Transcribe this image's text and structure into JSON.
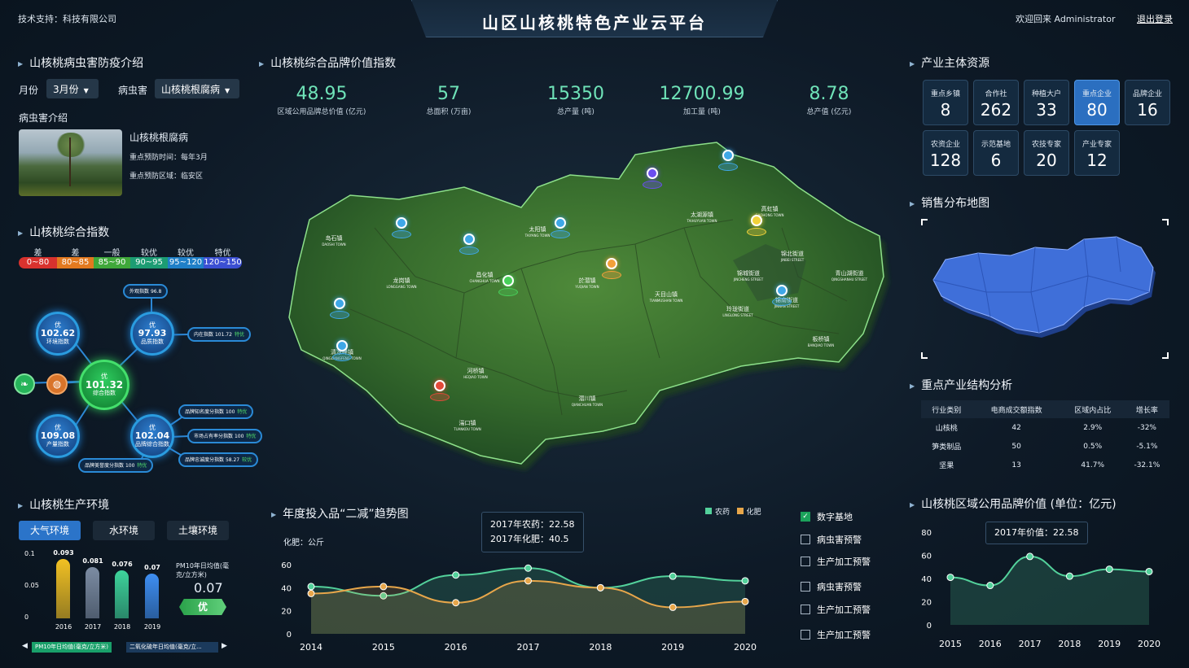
{
  "header": {
    "title": "山区山核桃特色产业云平台",
    "support": "技术支持：科技有限公司",
    "welcome": "欢迎回来  Administrator",
    "logout": "退出登录"
  },
  "pest": {
    "title": "山核桃病虫害防疫介绍",
    "month_label": "月份",
    "month_value": "3月份",
    "pest_label": "病虫害",
    "pest_value": "山核桃根腐病",
    "intro_label": "病虫害介绍",
    "name": "山核桃根腐病",
    "time": "重点预防时间：每年3月",
    "area": "重点预防区域：临安区"
  },
  "index": {
    "title": "山核桃综合指数",
    "scale": [
      {
        "grade": "差",
        "range": "0~80",
        "color": "#d8322e"
      },
      {
        "grade": "差",
        "range": "80~85",
        "color": "#e2791f"
      },
      {
        "grade": "一般",
        "range": "85~90",
        "color": "#3fa83a"
      },
      {
        "grade": "较优",
        "range": "90~95",
        "color": "#1c9c73"
      },
      {
        "grade": "较优",
        "range": "95~120",
        "color": "#1f7fc7"
      },
      {
        "grade": "特优",
        "range": "120~150",
        "color": "#3b4fd2"
      }
    ],
    "center": {
      "grade": "优",
      "value": "101.32",
      "name": "综合指数"
    },
    "env": {
      "grade": "优",
      "value": "102.62",
      "name": "环境指数"
    },
    "quality": {
      "grade": "优",
      "value": "97.93",
      "name": "品质指数"
    },
    "product": {
      "grade": "优",
      "value": "109.08",
      "name": "产量指数"
    },
    "brand": {
      "grade": "优",
      "value": "102.04",
      "name": "品牌综合指数"
    },
    "pills": {
      "appearance": {
        "label": "外观指数",
        "value": "96.8"
      },
      "inner": {
        "label": "内在指数",
        "value": "101.72",
        "grade": "特优"
      },
      "awareness": {
        "label": "品牌知名度分指数",
        "value": "100",
        "grade": "特优"
      },
      "market": {
        "label": "市场占有率分指数",
        "value": "100",
        "grade": "特优"
      },
      "loyalty": {
        "label": "品牌忠诚度分指数",
        "value": "58.27",
        "grade": "较优"
      },
      "reputation": {
        "label": "品牌美誉度分指数",
        "value": "100",
        "grade": "特优"
      }
    }
  },
  "environment": {
    "title": "山核桃生产环境",
    "tabs": [
      "大气环境",
      "水环境",
      "土壤环境"
    ],
    "chart_data": {
      "type": "bar",
      "categories": [
        "2016",
        "2017",
        "2018",
        "2019"
      ],
      "values": [
        0.093,
        0.081,
        0.076,
        0.07
      ],
      "value_labels": [
        "0.093",
        "0.081",
        "0.076",
        "0.07"
      ],
      "yticks": [
        "0.1",
        "0.05",
        "0"
      ],
      "ylim": [
        0,
        0.1
      ],
      "colors": [
        "#f2c123",
        "#7c8ca3",
        "#3ed39b",
        "#3e8ef2"
      ]
    },
    "pm_label": "PM10年日均值(毫克/立方米)",
    "pm_value": "0.07",
    "pm_grade": "优",
    "carousel": [
      "PM10年日均值(毫克/立方米)",
      "二氧化硫年日均值(毫克/立..."
    ]
  },
  "brand_value": {
    "title": "山核桃综合品牌价值指数",
    "kpis": [
      {
        "value": "48.95",
        "label": "区域公用品牌总价值 (亿元)"
      },
      {
        "value": "57",
        "label": "总面积 (万亩)"
      },
      {
        "value": "15350",
        "label": "总产量 (吨)"
      },
      {
        "value": "12700.99",
        "label": "加工量 (吨)"
      },
      {
        "value": "8.78",
        "label": "总产值 (亿元)"
      }
    ]
  },
  "map": {
    "towns": [
      {
        "name": "岛石镇",
        "en": "DAOSHI TOWN"
      },
      {
        "name": "太阳镇",
        "en": "TAIYANG TOWN"
      },
      {
        "name": "太湖源镇",
        "en": "TAIHUYUAN TOWN"
      },
      {
        "name": "高虹镇",
        "en": "GAOHONG TOWN"
      },
      {
        "name": "龙岗镇",
        "en": "LONGGANG TOWN"
      },
      {
        "name": "昌化镇",
        "en": "CHANGHUA TOWN"
      },
      {
        "name": "於潜镇",
        "en": "YUQIAN TOWN"
      },
      {
        "name": "锦城街道",
        "en": "JINCHENG STREET"
      },
      {
        "name": "锦北街道",
        "en": "JINBEI STREET"
      },
      {
        "name": "青山湖街道",
        "en": "QINGSHANHU STREET"
      },
      {
        "name": "天目山镇",
        "en": "TIANMUSHAN TOWN"
      },
      {
        "name": "玲珑街道",
        "en": "LINGLONG STREET"
      },
      {
        "name": "锦南街道",
        "en": "JINNAN STREET"
      },
      {
        "name": "清凉峰镇",
        "en": "QINGLIANGFENG TOWN"
      },
      {
        "name": "河桥镇",
        "en": "HEQIAO TOWN"
      },
      {
        "name": "潜川镇",
        "en": "QIANCHUAN TOWN"
      },
      {
        "name": "湍口镇",
        "en": "TUANKOU TOWN"
      },
      {
        "name": "板桥镇",
        "en": "BANQIAO TOWN"
      }
    ]
  },
  "trend": {
    "title": "年度投入品“二减”趋势图",
    "unit": "化肥：公斤",
    "legend": [
      "农药",
      "化肥"
    ],
    "tooltip": [
      "2017年农药：22.58",
      "2017年化肥：40.5"
    ],
    "chart_data": {
      "type": "area",
      "x": [
        "2014",
        "2015",
        "2016",
        "2017",
        "2018",
        "2019",
        "2020"
      ],
      "ylim": [
        0,
        60
      ],
      "yticks": [
        "60",
        "40",
        "20",
        "0"
      ],
      "series": [
        {
          "name": "农药",
          "values": [
            41,
            33,
            51,
            57,
            40,
            50,
            46
          ],
          "color": "#53d19b"
        },
        {
          "name": "化肥",
          "values": [
            35,
            41,
            27,
            46,
            40,
            23,
            28
          ],
          "color": "#e7a64a"
        }
      ]
    }
  },
  "layers": [
    "数字基地",
    "病虫害预警",
    "生产加工预警",
    "病虫害预警",
    "生产加工预警",
    "生产加工预警"
  ],
  "resources": {
    "title": "产业主体资源",
    "items": [
      {
        "label": "重点乡镇",
        "value": "8"
      },
      {
        "label": "合作社",
        "value": "262"
      },
      {
        "label": "种植大户",
        "value": "33"
      },
      {
        "label": "重点企业",
        "value": "80"
      },
      {
        "label": "品牌企业",
        "value": "16"
      },
      {
        "label": "农资企业",
        "value": "128"
      },
      {
        "label": "示范基地",
        "value": "6"
      },
      {
        "label": "农技专家",
        "value": "20"
      },
      {
        "label": "产业专家",
        "value": "12"
      }
    ]
  },
  "sales": {
    "title": "销售分布地图"
  },
  "structure": {
    "title": "重点产业结构分析",
    "headers": [
      "行业类别",
      "电商成交额指数",
      "区域内占比",
      "增长率"
    ],
    "rows": [
      [
        "山核桃",
        "42",
        "2.9%",
        "-32%"
      ],
      [
        "笋类制品",
        "50",
        "0.5%",
        "-5.1%"
      ],
      [
        "坚果",
        "13",
        "41.7%",
        "-32.1%"
      ]
    ]
  },
  "brand_chart": {
    "title": "山核桃区域公用品牌价值 (单位：亿元)",
    "tooltip": "2017年价值：22.58",
    "chart_data": {
      "type": "area",
      "x": [
        "2015",
        "2016",
        "2017",
        "2018",
        "2019",
        "2020"
      ],
      "ylim": [
        0,
        80
      ],
      "yticks": [
        "80",
        "60",
        "40",
        "20",
        "0"
      ],
      "series": [
        {
          "name": "",
          "values": [
            41,
            34,
            59,
            42,
            48,
            46
          ],
          "color": "#53d19b"
        }
      ]
    }
  }
}
